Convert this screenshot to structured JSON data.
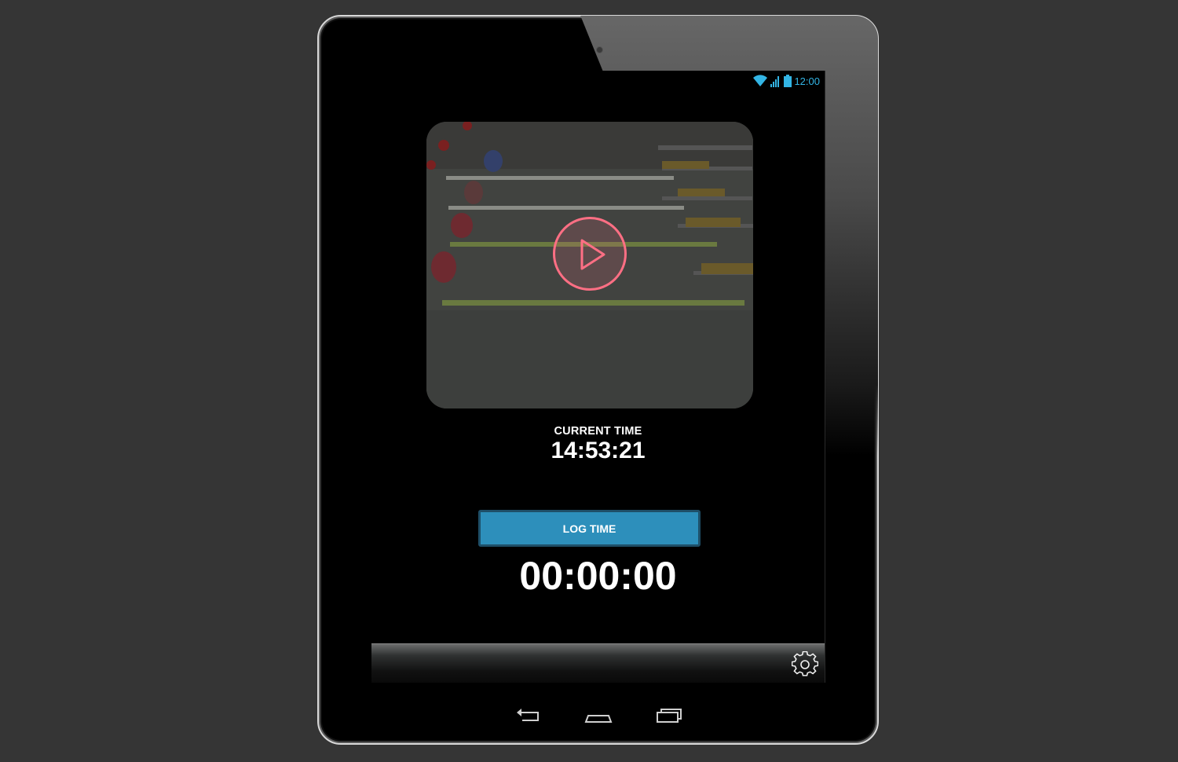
{
  "status_bar": {
    "time": "12:00",
    "icons": [
      "wifi-icon",
      "signal-icon",
      "battery-icon"
    ],
    "accent_color": "#33b5e5"
  },
  "video": {
    "thumbnail": "rowing race start photo",
    "play_icon": "play-icon",
    "play_color": "#ff6f84"
  },
  "clock": {
    "label": "CURRENT TIME",
    "value": "14:53:21"
  },
  "log": {
    "button_label": "LOG TIME",
    "button_color": "#2d8fbb",
    "elapsed": "00:00:00"
  },
  "bottom_bar": {
    "settings_icon": "gear-icon"
  },
  "navigation": {
    "buttons": [
      "back-icon",
      "home-icon",
      "recent-apps-icon"
    ]
  }
}
